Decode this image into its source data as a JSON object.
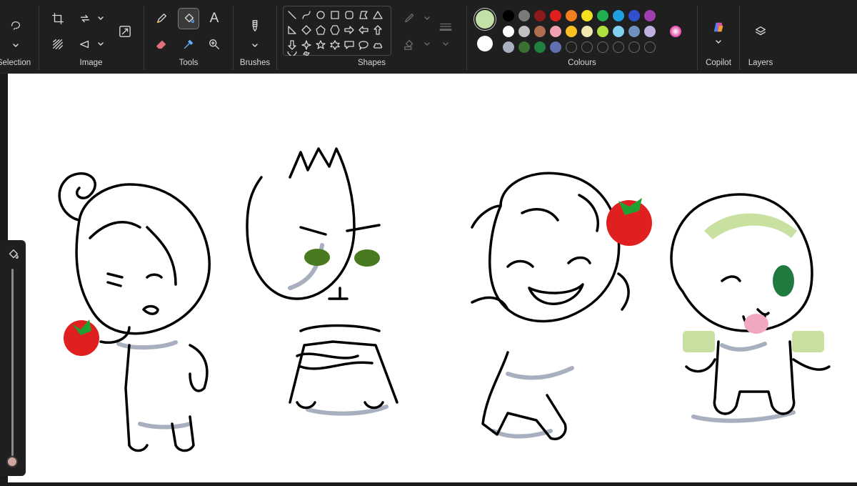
{
  "toolbar": {
    "groups": {
      "selection": "Selection",
      "image": "Image",
      "tools": "Tools",
      "brushes": "Brushes",
      "shapes": "Shapes",
      "colours": "Colours",
      "copilot": "Copilot",
      "layers": "Layers"
    },
    "tools": {
      "text_glyph": "A"
    },
    "colours": {
      "primary": "#c3e0a6",
      "secondary": "#ffffff",
      "palette_row1": [
        "#000000",
        "#7a7a7a",
        "#8b1a1a",
        "#e02020",
        "#f28020",
        "#f5e020",
        "#20b050",
        "#20a0e0",
        "#3050d0",
        "#a040b0"
      ],
      "palette_row2": [
        "#ffffff",
        "#c0c0c0",
        "#b07050",
        "#f0a0b0",
        "#f8c020",
        "#f0e8b0",
        "#b0e040",
        "#80d0f0",
        "#7090c0",
        "#c0b0e0"
      ],
      "palette_row3": [
        "#a8b0c0",
        "#3a7030",
        "#208040",
        "#6070b0",
        "",
        "",
        "",
        "",
        "",
        ""
      ]
    }
  }
}
